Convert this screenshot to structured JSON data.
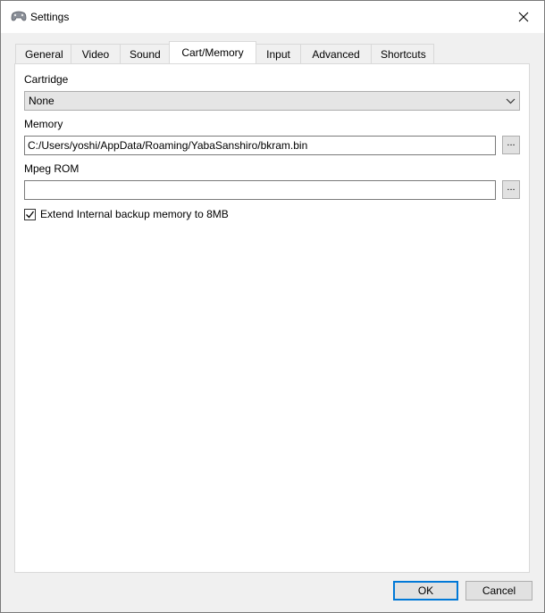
{
  "window": {
    "title": "Settings"
  },
  "tabs": [
    {
      "label": "General"
    },
    {
      "label": "Video"
    },
    {
      "label": "Sound"
    },
    {
      "label": "Cart/Memory"
    },
    {
      "label": "Input"
    },
    {
      "label": "Advanced"
    },
    {
      "label": "Shortcuts"
    }
  ],
  "active_tab": "Cart/Memory",
  "cartridge": {
    "label": "Cartridge",
    "value": "None"
  },
  "memory": {
    "label": "Memory",
    "value": "C:/Users/yoshi/AppData/Roaming/YabaSanshiro/bkram.bin",
    "browse": "..."
  },
  "mpeg_rom": {
    "label": "Mpeg ROM",
    "value": "",
    "browse": "..."
  },
  "extend_backup": {
    "label": "Extend Internal backup memory to 8MB",
    "checked": true
  },
  "buttons": {
    "ok": "OK",
    "cancel": "Cancel"
  },
  "colors": {
    "accent": "#0078d7",
    "panel_bg": "#ffffff",
    "window_bg": "#f0f0f0"
  }
}
